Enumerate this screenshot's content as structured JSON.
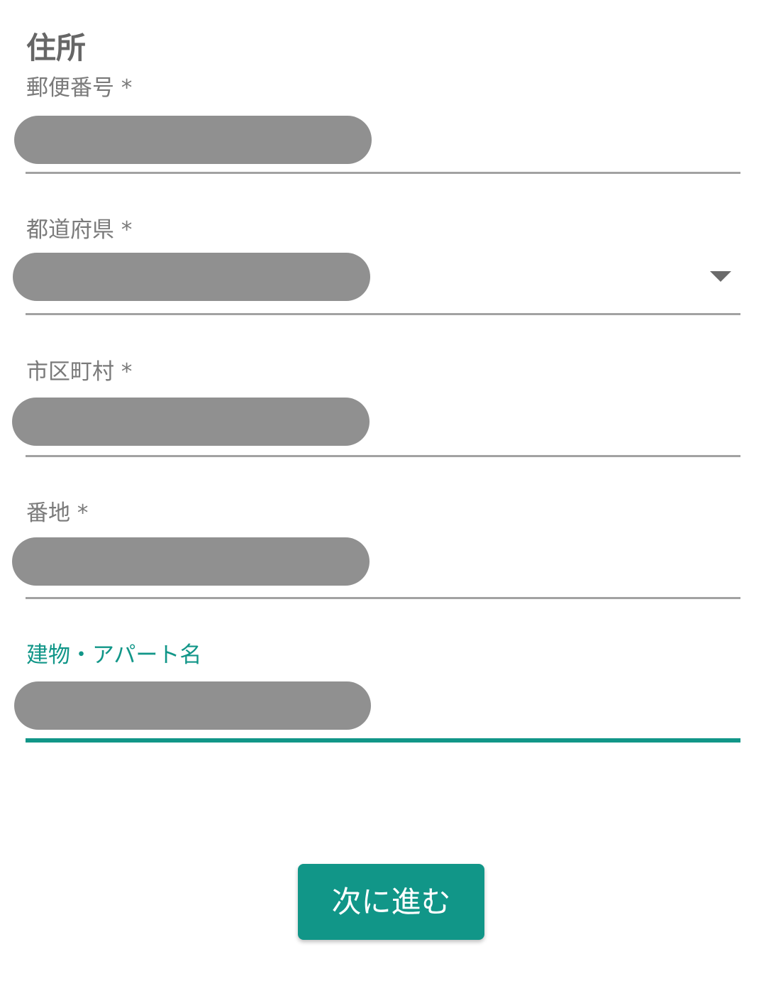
{
  "section": {
    "title": "住所"
  },
  "fields": [
    {
      "label": "郵便番号 *",
      "required": true,
      "focused": false,
      "type": "text"
    },
    {
      "label": "都道府県 *",
      "required": true,
      "focused": false,
      "type": "select"
    },
    {
      "label": "市区町村 *",
      "required": true,
      "focused": false,
      "type": "text"
    },
    {
      "label": "番地 *",
      "required": true,
      "focused": false,
      "type": "text"
    },
    {
      "label": "建物・アパート名",
      "required": false,
      "focused": true,
      "type": "text"
    }
  ],
  "actions": {
    "next_label": "次に進む"
  },
  "colors": {
    "accent": "#119688",
    "label": "#7a7a7a",
    "title": "#666666",
    "redacted_value": "#909090",
    "underline": "#a2a2a2"
  },
  "icons": {
    "dropdown": "caret-down-icon"
  }
}
